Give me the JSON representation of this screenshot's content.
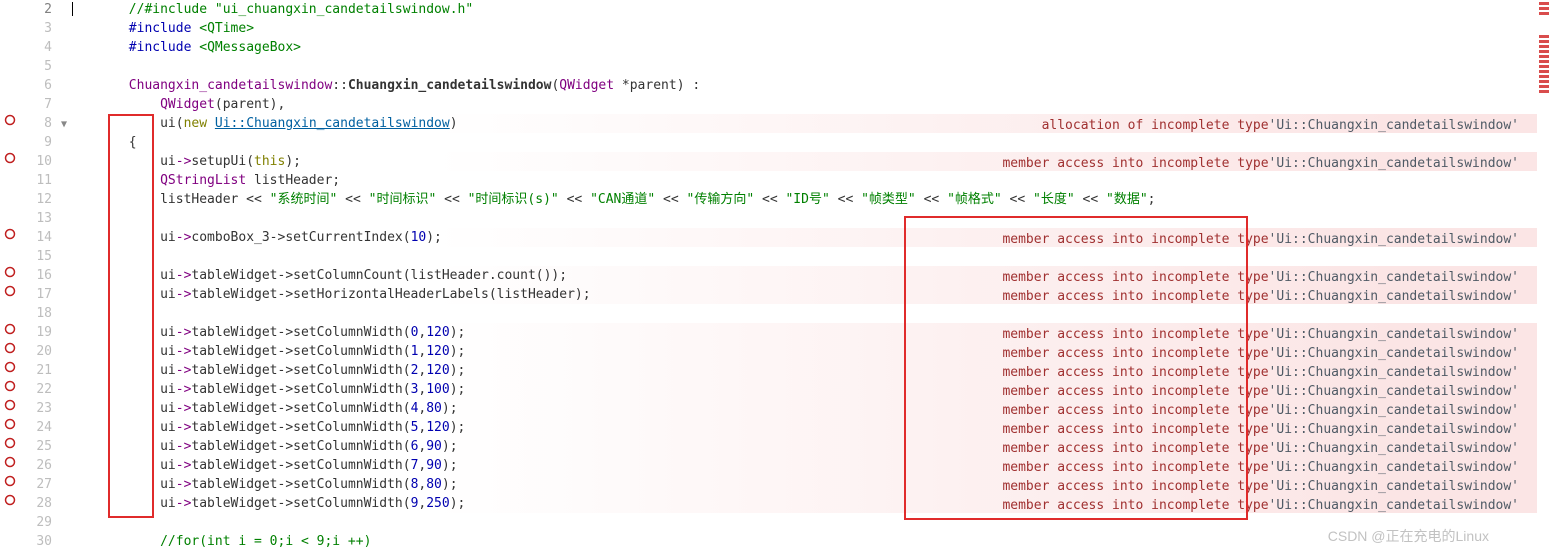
{
  "watermark": "CSDN @正在充电的Linux",
  "lines": [
    {
      "num": "2",
      "active": true,
      "marker": "none",
      "fold": false,
      "cursor": true,
      "tokens": [
        {
          "t": "       ",
          "c": ""
        },
        {
          "t": "//#include \"ui_chuangxin_candetailswindow.h\"",
          "c": "tk-comment"
        }
      ]
    },
    {
      "num": "3",
      "marker": "none",
      "fold": false,
      "tokens": [
        {
          "t": "       ",
          "c": ""
        },
        {
          "t": "#include",
          "c": "tk-pp"
        },
        {
          "t": " ",
          "c": ""
        },
        {
          "t": "<QTime>",
          "c": "tk-str"
        }
      ]
    },
    {
      "num": "4",
      "marker": "none",
      "fold": false,
      "tokens": [
        {
          "t": "       ",
          "c": ""
        },
        {
          "t": "#include",
          "c": "tk-pp"
        },
        {
          "t": " ",
          "c": ""
        },
        {
          "t": "<QMessageBox>",
          "c": "tk-str"
        }
      ]
    },
    {
      "num": "5",
      "marker": "none",
      "fold": false,
      "tokens": [
        {
          "t": "",
          "c": ""
        }
      ]
    },
    {
      "num": "6",
      "marker": "none",
      "fold": false,
      "tokens": [
        {
          "t": "       ",
          "c": ""
        },
        {
          "t": "Chuangxin_candetailswindow",
          "c": "tk-type"
        },
        {
          "t": "::",
          "c": ""
        },
        {
          "t": "Chuangxin_candetailswindow",
          "c": "tk-func"
        },
        {
          "t": "(",
          "c": ""
        },
        {
          "t": "QWidget",
          "c": "tk-type"
        },
        {
          "t": " *parent) :",
          "c": ""
        }
      ]
    },
    {
      "num": "7",
      "marker": "none",
      "fold": false,
      "tokens": [
        {
          "t": "           ",
          "c": ""
        },
        {
          "t": "QWidget",
          "c": "tk-type"
        },
        {
          "t": "(parent),",
          "c": ""
        }
      ]
    },
    {
      "num": "8",
      "marker": "error",
      "fold": true,
      "errbg": true,
      "annot": {
        "label": "allocation of incomplete type ",
        "type": "'Ui::Chuangxin_candetailswindow'"
      },
      "tokens": [
        {
          "t": "           ",
          "c": ""
        },
        {
          "t": "ui(",
          "c": ""
        },
        {
          "t": "new",
          "c": "tk-kw"
        },
        {
          "t": " ",
          "c": ""
        },
        {
          "t": "Ui",
          "c": "tk-ulink"
        },
        {
          "t": "::",
          "c": "tk-ulink"
        },
        {
          "t": "Chuangxin_candetailswindow",
          "c": "tk-ulink"
        },
        {
          "t": ")",
          "c": ""
        }
      ]
    },
    {
      "num": "9",
      "marker": "none",
      "fold": false,
      "tokens": [
        {
          "t": "       {",
          "c": ""
        }
      ]
    },
    {
      "num": "10",
      "marker": "error",
      "fold": false,
      "errbg": true,
      "annot": {
        "label": "member access into incomplete type ",
        "type": "'Ui::Chuangxin_candetailswindow'"
      },
      "tokens": [
        {
          "t": "           ui",
          "c": ""
        },
        {
          "t": "->",
          "c": "tk-type"
        },
        {
          "t": "setupUi(",
          "c": ""
        },
        {
          "t": "this",
          "c": "tk-kw"
        },
        {
          "t": ");",
          "c": ""
        }
      ]
    },
    {
      "num": "11",
      "marker": "none",
      "fold": false,
      "tokens": [
        {
          "t": "           ",
          "c": ""
        },
        {
          "t": "QStringList",
          "c": "tk-type"
        },
        {
          "t": " listHeader;",
          "c": ""
        }
      ]
    },
    {
      "num": "12",
      "marker": "none",
      "fold": false,
      "tokens": [
        {
          "t": "           listHeader << ",
          "c": ""
        },
        {
          "t": "\"系统时间\"",
          "c": "tk-str"
        },
        {
          "t": " << ",
          "c": ""
        },
        {
          "t": "\"时间标识\"",
          "c": "tk-str"
        },
        {
          "t": " << ",
          "c": ""
        },
        {
          "t": "\"时间标识(s)\"",
          "c": "tk-str"
        },
        {
          "t": " << ",
          "c": ""
        },
        {
          "t": "\"CAN通道\"",
          "c": "tk-str"
        },
        {
          "t": " << ",
          "c": ""
        },
        {
          "t": "\"传输方向\"",
          "c": "tk-str"
        },
        {
          "t": " << ",
          "c": ""
        },
        {
          "t": "\"ID号\"",
          "c": "tk-str"
        },
        {
          "t": " << ",
          "c": ""
        },
        {
          "t": "\"帧类型\"",
          "c": "tk-str"
        },
        {
          "t": " << ",
          "c": ""
        },
        {
          "t": "\"帧格式\"",
          "c": "tk-str"
        },
        {
          "t": " << ",
          "c": ""
        },
        {
          "t": "\"长度\"",
          "c": "tk-str"
        },
        {
          "t": " << ",
          "c": ""
        },
        {
          "t": "\"数据\"",
          "c": "tk-str"
        },
        {
          "t": ";",
          "c": ""
        }
      ]
    },
    {
      "num": "13",
      "marker": "none",
      "fold": false,
      "tokens": [
        {
          "t": "",
          "c": ""
        }
      ]
    },
    {
      "num": "14",
      "marker": "error",
      "fold": false,
      "errbg": true,
      "annot": {
        "label": "member access into incomplete type ",
        "type": "'Ui::Chuangxin_candetailswindow'"
      },
      "tokens": [
        {
          "t": "           ui",
          "c": ""
        },
        {
          "t": "->",
          "c": "tk-type"
        },
        {
          "t": "comboBox_3->setCurrentIndex(",
          "c": ""
        },
        {
          "t": "10",
          "c": "tk-num"
        },
        {
          "t": ");",
          "c": ""
        }
      ]
    },
    {
      "num": "15",
      "marker": "none",
      "fold": false,
      "tokens": [
        {
          "t": "",
          "c": ""
        }
      ]
    },
    {
      "num": "16",
      "marker": "error",
      "fold": false,
      "errbg": true,
      "annot": {
        "label": "member access into incomplete type ",
        "type": "'Ui::Chuangxin_candetailswindow'"
      },
      "tokens": [
        {
          "t": "           ui",
          "c": ""
        },
        {
          "t": "->",
          "c": "tk-type"
        },
        {
          "t": "tableWidget->setColumnCount(listHeader.count());",
          "c": ""
        }
      ]
    },
    {
      "num": "17",
      "marker": "error",
      "fold": false,
      "errbg": true,
      "annot": {
        "label": "member access into incomplete type ",
        "type": "'Ui::Chuangxin_candetailswindow'"
      },
      "tokens": [
        {
          "t": "           ui",
          "c": ""
        },
        {
          "t": "->",
          "c": "tk-type"
        },
        {
          "t": "tableWidget->setHorizontalHeaderLabels(listHeader);",
          "c": ""
        }
      ]
    },
    {
      "num": "18",
      "marker": "none",
      "fold": false,
      "tokens": [
        {
          "t": "",
          "c": ""
        }
      ]
    },
    {
      "num": "19",
      "marker": "error",
      "fold": false,
      "errbg": true,
      "annot": {
        "label": "member access into incomplete type ",
        "type": "'Ui::Chuangxin_candetailswindow'"
      },
      "tokens": [
        {
          "t": "           ui",
          "c": ""
        },
        {
          "t": "->",
          "c": "tk-type"
        },
        {
          "t": "tableWidget->setColumnWidth(",
          "c": ""
        },
        {
          "t": "0",
          "c": "tk-num"
        },
        {
          "t": ",",
          "c": ""
        },
        {
          "t": "120",
          "c": "tk-num"
        },
        {
          "t": ");",
          "c": ""
        }
      ]
    },
    {
      "num": "20",
      "marker": "error",
      "fold": false,
      "errbg": true,
      "annot": {
        "label": "member access into incomplete type ",
        "type": "'Ui::Chuangxin_candetailswindow'"
      },
      "tokens": [
        {
          "t": "           ui",
          "c": ""
        },
        {
          "t": "->",
          "c": "tk-type"
        },
        {
          "t": "tableWidget->setColumnWidth(",
          "c": ""
        },
        {
          "t": "1",
          "c": "tk-num"
        },
        {
          "t": ",",
          "c": ""
        },
        {
          "t": "120",
          "c": "tk-num"
        },
        {
          "t": ");",
          "c": ""
        }
      ]
    },
    {
      "num": "21",
      "marker": "error",
      "fold": false,
      "errbg": true,
      "annot": {
        "label": "member access into incomplete type ",
        "type": "'Ui::Chuangxin_candetailswindow'"
      },
      "tokens": [
        {
          "t": "           ui",
          "c": ""
        },
        {
          "t": "->",
          "c": "tk-type"
        },
        {
          "t": "tableWidget->setColumnWidth(",
          "c": ""
        },
        {
          "t": "2",
          "c": "tk-num"
        },
        {
          "t": ",",
          "c": ""
        },
        {
          "t": "120",
          "c": "tk-num"
        },
        {
          "t": ");",
          "c": ""
        }
      ]
    },
    {
      "num": "22",
      "marker": "error",
      "fold": false,
      "errbg": true,
      "annot": {
        "label": "member access into incomplete type ",
        "type": "'Ui::Chuangxin_candetailswindow'"
      },
      "tokens": [
        {
          "t": "           ui",
          "c": ""
        },
        {
          "t": "->",
          "c": "tk-type"
        },
        {
          "t": "tableWidget->setColumnWidth(",
          "c": ""
        },
        {
          "t": "3",
          "c": "tk-num"
        },
        {
          "t": ",",
          "c": ""
        },
        {
          "t": "100",
          "c": "tk-num"
        },
        {
          "t": ");",
          "c": ""
        }
      ]
    },
    {
      "num": "23",
      "marker": "error",
      "fold": false,
      "errbg": true,
      "annot": {
        "label": "member access into incomplete type ",
        "type": "'Ui::Chuangxin_candetailswindow'"
      },
      "tokens": [
        {
          "t": "           ui",
          "c": ""
        },
        {
          "t": "->",
          "c": "tk-type"
        },
        {
          "t": "tableWidget->setColumnWidth(",
          "c": ""
        },
        {
          "t": "4",
          "c": "tk-num"
        },
        {
          "t": ",",
          "c": ""
        },
        {
          "t": "80",
          "c": "tk-num"
        },
        {
          "t": ");",
          "c": ""
        }
      ]
    },
    {
      "num": "24",
      "marker": "error",
      "fold": false,
      "errbg": true,
      "annot": {
        "label": "member access into incomplete type ",
        "type": "'Ui::Chuangxin_candetailswindow'"
      },
      "tokens": [
        {
          "t": "           ui",
          "c": ""
        },
        {
          "t": "->",
          "c": "tk-type"
        },
        {
          "t": "tableWidget->setColumnWidth(",
          "c": ""
        },
        {
          "t": "5",
          "c": "tk-num"
        },
        {
          "t": ",",
          "c": ""
        },
        {
          "t": "120",
          "c": "tk-num"
        },
        {
          "t": ");",
          "c": ""
        }
      ]
    },
    {
      "num": "25",
      "marker": "error",
      "fold": false,
      "errbg": true,
      "annot": {
        "label": "member access into incomplete type ",
        "type": "'Ui::Chuangxin_candetailswindow'"
      },
      "tokens": [
        {
          "t": "           ui",
          "c": ""
        },
        {
          "t": "->",
          "c": "tk-type"
        },
        {
          "t": "tableWidget->setColumnWidth(",
          "c": ""
        },
        {
          "t": "6",
          "c": "tk-num"
        },
        {
          "t": ",",
          "c": ""
        },
        {
          "t": "90",
          "c": "tk-num"
        },
        {
          "t": ");",
          "c": ""
        }
      ]
    },
    {
      "num": "26",
      "marker": "error",
      "fold": false,
      "errbg": true,
      "annot": {
        "label": "member access into incomplete type ",
        "type": "'Ui::Chuangxin_candetailswindow'"
      },
      "tokens": [
        {
          "t": "           ui",
          "c": ""
        },
        {
          "t": "->",
          "c": "tk-type"
        },
        {
          "t": "tableWidget->setColumnWidth(",
          "c": ""
        },
        {
          "t": "7",
          "c": "tk-num"
        },
        {
          "t": ",",
          "c": ""
        },
        {
          "t": "90",
          "c": "tk-num"
        },
        {
          "t": ");",
          "c": ""
        }
      ]
    },
    {
      "num": "27",
      "marker": "error",
      "fold": false,
      "errbg": true,
      "annot": {
        "label": "member access into incomplete type ",
        "type": "'Ui::Chuangxin_candetailswindow'"
      },
      "tokens": [
        {
          "t": "           ui",
          "c": ""
        },
        {
          "t": "->",
          "c": "tk-type"
        },
        {
          "t": "tableWidget->setColumnWidth(",
          "c": ""
        },
        {
          "t": "8",
          "c": "tk-num"
        },
        {
          "t": ",",
          "c": ""
        },
        {
          "t": "80",
          "c": "tk-num"
        },
        {
          "t": ");",
          "c": ""
        }
      ]
    },
    {
      "num": "28",
      "marker": "error",
      "fold": false,
      "errbg": true,
      "annot": {
        "label": "member access into incomplete type ",
        "type": "'Ui::Chuangxin_candetailswindow'"
      },
      "tokens": [
        {
          "t": "           ui",
          "c": ""
        },
        {
          "t": "->",
          "c": "tk-type"
        },
        {
          "t": "tableWidget->setColumnWidth(",
          "c": ""
        },
        {
          "t": "9",
          "c": "tk-num"
        },
        {
          "t": ",",
          "c": ""
        },
        {
          "t": "250",
          "c": "tk-num"
        },
        {
          "t": ");",
          "c": ""
        }
      ]
    },
    {
      "num": "29",
      "marker": "none",
      "fold": false,
      "tokens": [
        {
          "t": "",
          "c": ""
        }
      ]
    },
    {
      "num": "30",
      "marker": "none",
      "fold": false,
      "tokens": [
        {
          "t": "           ",
          "c": ""
        },
        {
          "t": "//for(int i = 0;i < 9;i ++)",
          "c": "tk-comment"
        }
      ]
    }
  ],
  "minimap_count": 15
}
